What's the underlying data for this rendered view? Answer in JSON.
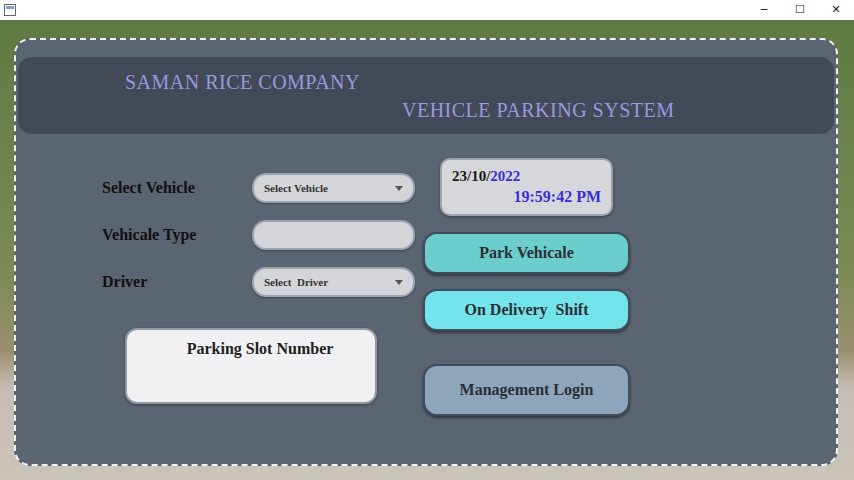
{
  "window": {
    "controls": [
      "─",
      "☐",
      "✕"
    ]
  },
  "header": {
    "company": "SAMAN RICE COMPANY",
    "system": "VEHICLE PARKING SYSTEM"
  },
  "form": {
    "fields": [
      {
        "label": "Select Vehicle",
        "kind": "dropdown",
        "value": "Select Vehicle"
      },
      {
        "label": "Vehicale Type",
        "kind": "text",
        "value": ""
      },
      {
        "label": "Driver",
        "kind": "dropdown",
        "value": "Select  Driver"
      }
    ]
  },
  "slot": {
    "label": "Parking Slot Number"
  },
  "clock": {
    "date_day_month": "23/10/",
    "date_year": "2022",
    "time": "19:59:42 PM"
  },
  "buttons": [
    {
      "label": "Park Vehicale",
      "color": "#6ccdcd"
    },
    {
      "label": "On Delivery  Shift",
      "color": "#74e4ec"
    },
    {
      "label": "Management Login",
      "color": "#8fa5bb"
    }
  ]
}
